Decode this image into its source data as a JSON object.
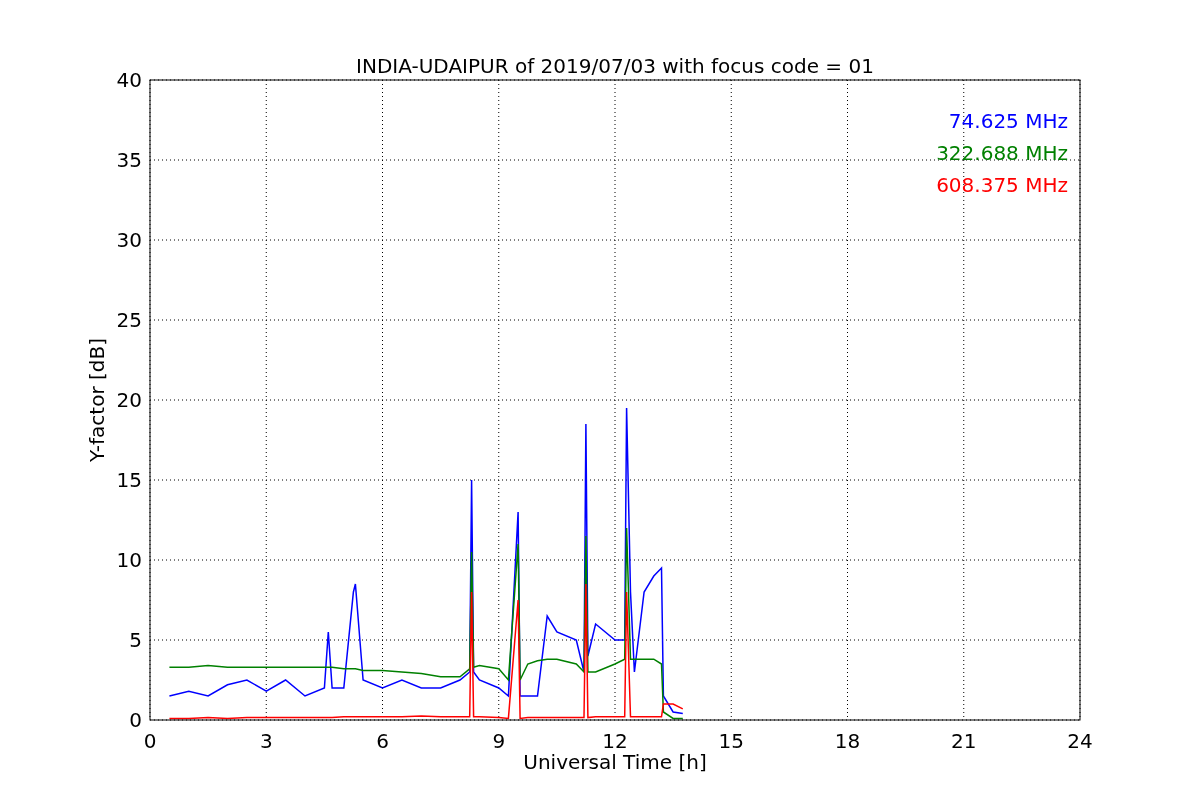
{
  "figure": {
    "chart_data": {
      "type": "line",
      "title": "INDIA-UDAIPUR of 2019/07/03 with focus code = 01",
      "xlabel": "Universal Time [h]",
      "ylabel": "Y-factor [dB]",
      "x": [
        0.5,
        1,
        1.5,
        2,
        2.5,
        3,
        3.5,
        4,
        4.5,
        4.6,
        4.7,
        5,
        5.25,
        5.3,
        5.5,
        6,
        6.5,
        7,
        7.5,
        8,
        8.25,
        8.3,
        8.35,
        8.5,
        9,
        9.25,
        9.5,
        9.55,
        9.75,
        10,
        10.25,
        10.5,
        11,
        11.2,
        11.25,
        11.3,
        11.5,
        12,
        12.25,
        12.3,
        12.4,
        12.5,
        12.75,
        13,
        13.2,
        13.25,
        13.5,
        13.75
      ],
      "series": [
        {
          "name": "74.625 MHz",
          "color": "#0000ff",
          "values": [
            1.5,
            1.8,
            1.5,
            2.2,
            2.5,
            1.8,
            2.5,
            1.5,
            2.0,
            5.5,
            2.0,
            2.0,
            8.0,
            8.5,
            2.5,
            2.0,
            2.5,
            2.0,
            2.0,
            2.5,
            3.0,
            15.0,
            3.0,
            2.5,
            2.0,
            1.5,
            13.0,
            1.5,
            1.5,
            1.5,
            6.5,
            5.5,
            5.0,
            3.0,
            18.5,
            4.0,
            6.0,
            5.0,
            5.0,
            19.5,
            8.0,
            3.0,
            8.0,
            9.0,
            9.5,
            1.5,
            0.5,
            0.4
          ]
        },
        {
          "name": "322.688 MHz",
          "color": "#008000",
          "values": [
            3.3,
            3.3,
            3.4,
            3.3,
            3.3,
            3.3,
            3.3,
            3.3,
            3.3,
            3.3,
            3.3,
            3.2,
            3.2,
            3.2,
            3.1,
            3.1,
            3.0,
            2.9,
            2.7,
            2.7,
            3.2,
            10.5,
            3.3,
            3.4,
            3.2,
            2.5,
            11.0,
            2.5,
            3.5,
            3.7,
            3.8,
            3.8,
            3.5,
            3.0,
            11.5,
            3.0,
            3.0,
            3.5,
            3.8,
            12.0,
            3.8,
            3.8,
            3.8,
            3.8,
            3.5,
            0.5,
            0.1,
            0.1
          ]
        },
        {
          "name": "608.375 MHz",
          "color": "#ff0000",
          "values": [
            0.1,
            0.1,
            0.15,
            0.1,
            0.15,
            0.15,
            0.15,
            0.15,
            0.15,
            0.15,
            0.15,
            0.2,
            0.2,
            0.2,
            0.2,
            0.2,
            0.2,
            0.25,
            0.2,
            0.2,
            0.2,
            8.0,
            0.2,
            0.2,
            0.15,
            0.1,
            7.5,
            0.1,
            0.15,
            0.15,
            0.15,
            0.15,
            0.15,
            0.15,
            8.5,
            0.15,
            0.2,
            0.2,
            0.2,
            8.0,
            0.2,
            0.2,
            0.2,
            0.2,
            0.2,
            1.0,
            1.0,
            0.7
          ]
        }
      ],
      "grid": true,
      "xlim": [
        0,
        24
      ],
      "ylim": [
        0,
        40
      ],
      "xticks": [
        0,
        3,
        6,
        9,
        12,
        15,
        18,
        21,
        24
      ],
      "yticks": [
        0,
        5,
        10,
        15,
        20,
        25,
        30,
        35,
        40
      ]
    }
  }
}
